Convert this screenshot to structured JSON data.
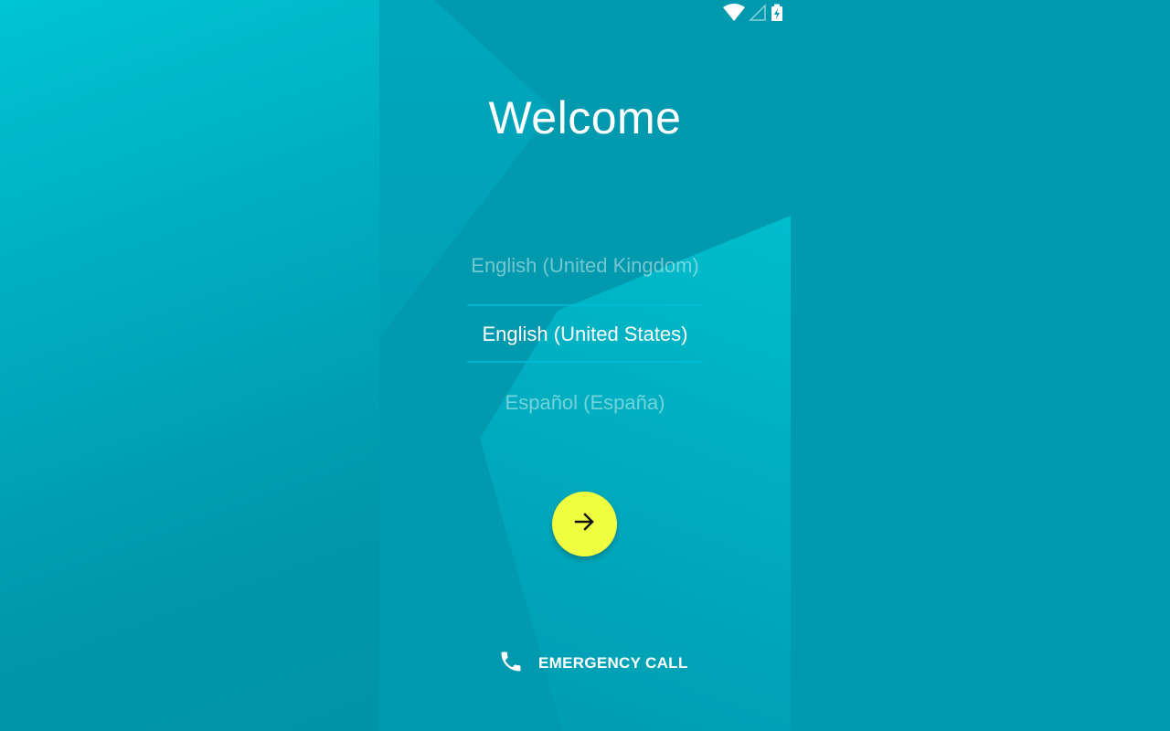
{
  "screen": {
    "title": "Welcome"
  },
  "status_bar": {
    "icons": [
      "wifi-icon",
      "cell-signal-icon",
      "battery-charging-icon"
    ]
  },
  "language_picker": {
    "options": [
      {
        "label": "English (United Kingdom)",
        "selected": false
      },
      {
        "label": "English (United States)",
        "selected": true
      },
      {
        "label": "Español (España)",
        "selected": false
      }
    ]
  },
  "next_button": {
    "icon": "arrow-right-icon",
    "color": "#eeff41"
  },
  "emergency_call": {
    "icon": "phone-icon",
    "label": "EMERGENCY CALL"
  },
  "colors": {
    "background": "#0099ad",
    "accent_light": "#00c4d2",
    "text": "#ffffff"
  }
}
